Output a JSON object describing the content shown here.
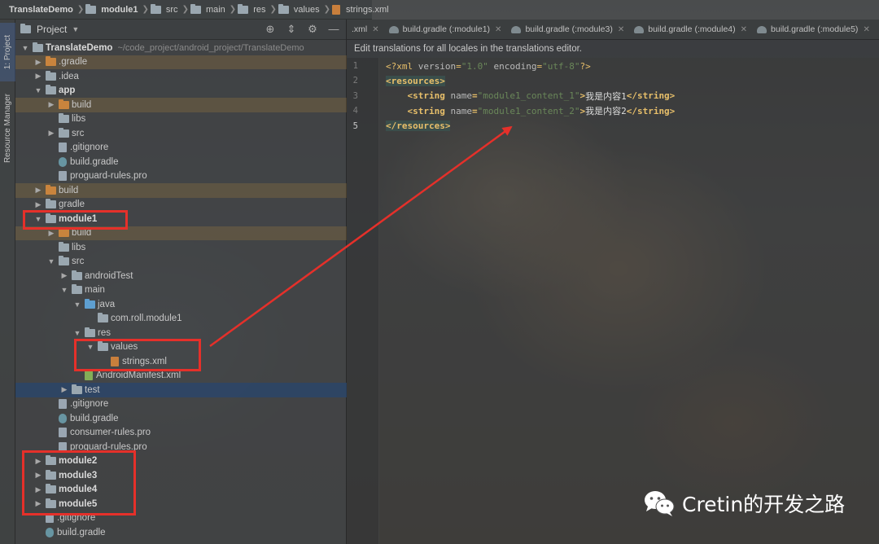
{
  "breadcrumb": [
    {
      "label": "TranslateDemo",
      "bold": true,
      "icon": "folder-icon"
    },
    {
      "label": "module1",
      "bold": true,
      "icon": "module-folder-icon"
    },
    {
      "label": "src",
      "bold": false,
      "icon": "folder-icon"
    },
    {
      "label": "main",
      "bold": false,
      "icon": "folder-icon"
    },
    {
      "label": "res",
      "bold": false,
      "icon": "folder-icon"
    },
    {
      "label": "values",
      "bold": false,
      "icon": "folder-icon"
    },
    {
      "label": "strings.xml",
      "bold": false,
      "icon": "xml-file-icon"
    }
  ],
  "tool_strip": {
    "project_tab": "1: Project",
    "resource_manager_tab": "Resource Manager"
  },
  "project_panel": {
    "title": "Project",
    "tools": [
      "target-icon",
      "collapse-all-icon",
      "settings-icon",
      "hide-icon"
    ],
    "tree": [
      {
        "label": "TranslateDemo",
        "depth": 0,
        "expanded": true,
        "icon": "module-folder-icon",
        "bold": true,
        "path": "~/code_project/android_project/TranslateDemo"
      },
      {
        "label": ".gradle",
        "depth": 1,
        "expanded": false,
        "icon": "orange-folder-icon",
        "highlight": "orange"
      },
      {
        "label": ".idea",
        "depth": 1,
        "expanded": false,
        "icon": "folder-icon"
      },
      {
        "label": "app",
        "depth": 1,
        "expanded": true,
        "icon": "module-folder-icon",
        "bold": true
      },
      {
        "label": "build",
        "depth": 2,
        "expanded": false,
        "icon": "orange-folder-icon",
        "highlight": "orange"
      },
      {
        "label": "libs",
        "depth": 2,
        "icon": "folder-icon"
      },
      {
        "label": "src",
        "depth": 2,
        "expanded": false,
        "icon": "folder-icon"
      },
      {
        "label": ".gitignore",
        "depth": 2,
        "icon": "gitignore-file-icon"
      },
      {
        "label": "build.gradle",
        "depth": 2,
        "icon": "gradle-file-icon"
      },
      {
        "label": "proguard-rules.pro",
        "depth": 2,
        "icon": "text-file-icon"
      },
      {
        "label": "build",
        "depth": 1,
        "expanded": false,
        "icon": "orange-folder-icon",
        "highlight": "orange"
      },
      {
        "label": "gradle",
        "depth": 1,
        "expanded": false,
        "icon": "folder-icon"
      },
      {
        "label": "module1",
        "depth": 1,
        "expanded": true,
        "icon": "module-folder-icon",
        "bold": true
      },
      {
        "label": "build",
        "depth": 2,
        "expanded": false,
        "icon": "orange-folder-icon",
        "highlight": "orange"
      },
      {
        "label": "libs",
        "depth": 2,
        "icon": "folder-icon"
      },
      {
        "label": "src",
        "depth": 2,
        "expanded": true,
        "icon": "folder-icon"
      },
      {
        "label": "androidTest",
        "depth": 3,
        "expanded": false,
        "icon": "folder-icon"
      },
      {
        "label": "main",
        "depth": 3,
        "expanded": true,
        "icon": "folder-icon"
      },
      {
        "label": "java",
        "depth": 4,
        "expanded": true,
        "icon": "blue-folder-icon"
      },
      {
        "label": "com.roll.module1",
        "depth": 5,
        "icon": "package-icon"
      },
      {
        "label": "res",
        "depth": 4,
        "expanded": true,
        "icon": "res-folder-icon"
      },
      {
        "label": "values",
        "depth": 5,
        "expanded": true,
        "icon": "folder-icon"
      },
      {
        "label": "strings.xml",
        "depth": 6,
        "icon": "xml-file-icon"
      },
      {
        "label": "AndroidManifest.xml",
        "depth": 4,
        "icon": "manifest-file-icon"
      },
      {
        "label": "test",
        "depth": 3,
        "expanded": false,
        "icon": "folder-icon",
        "selected": true
      },
      {
        "label": ".gitignore",
        "depth": 2,
        "icon": "gitignore-file-icon"
      },
      {
        "label": "build.gradle",
        "depth": 2,
        "icon": "gradle-file-icon"
      },
      {
        "label": "consumer-rules.pro",
        "depth": 2,
        "icon": "text-file-icon"
      },
      {
        "label": "proguard-rules.pro",
        "depth": 2,
        "icon": "text-file-icon"
      },
      {
        "label": "module2",
        "depth": 1,
        "expanded": false,
        "icon": "module-folder-icon",
        "bold": true
      },
      {
        "label": "module3",
        "depth": 1,
        "expanded": false,
        "icon": "module-folder-icon",
        "bold": true
      },
      {
        "label": "module4",
        "depth": 1,
        "expanded": false,
        "icon": "module-folder-icon",
        "bold": true
      },
      {
        "label": "module5",
        "depth": 1,
        "expanded": false,
        "icon": "module-folder-icon",
        "bold": true
      },
      {
        "label": ".gitignore",
        "depth": 1,
        "icon": "gitignore-file-icon"
      },
      {
        "label": "build.gradle",
        "depth": 1,
        "icon": "gradle-file-icon"
      }
    ]
  },
  "editor": {
    "tabs": [
      {
        "label": ".xml",
        "icon": "xml-file-icon"
      },
      {
        "label": "build.gradle (:module1)",
        "icon": "gradle-file-icon"
      },
      {
        "label": "build.gradle (:module3)",
        "icon": "gradle-file-icon"
      },
      {
        "label": "build.gradle (:module4)",
        "icon": "gradle-file-icon"
      },
      {
        "label": "build.gradle (:module5)",
        "icon": "gradle-file-icon"
      },
      {
        "label": "b",
        "icon": "gradle-file-icon"
      }
    ],
    "notice": "Edit translations for all locales in the translations editor.",
    "line_numbers": [
      "1",
      "2",
      "3",
      "4",
      "5"
    ],
    "current_line": 5,
    "code": [
      {
        "indent": "",
        "parts": [
          [
            "pi",
            "<?xml "
          ],
          [
            "attr",
            "version"
          ],
          [
            "pi",
            "="
          ],
          [
            "val",
            "\"1.0\""
          ],
          [
            "pi",
            " "
          ],
          [
            "attr",
            "encoding"
          ],
          [
            "pi",
            "="
          ],
          [
            "val",
            "\"utf-8\""
          ],
          [
            "pi",
            "?>"
          ]
        ]
      },
      {
        "indent": "",
        "parts": [
          [
            "taghl",
            "<resources>"
          ]
        ]
      },
      {
        "indent": "    ",
        "parts": [
          [
            "tag",
            "<string "
          ],
          [
            "attr",
            "name"
          ],
          [
            "tag",
            "="
          ],
          [
            "val",
            "\"module1_content_1\""
          ],
          [
            "tag",
            ">"
          ],
          [
            "text",
            "我是内容1"
          ],
          [
            "tag",
            "</string>"
          ]
        ]
      },
      {
        "indent": "    ",
        "parts": [
          [
            "tag",
            "<string "
          ],
          [
            "attr",
            "name"
          ],
          [
            "tag",
            "="
          ],
          [
            "val",
            "\"module1_content_2\""
          ],
          [
            "tag",
            ">"
          ],
          [
            "text",
            "我是内容2"
          ],
          [
            "tag",
            "</string>"
          ]
        ]
      },
      {
        "indent": "",
        "parts": [
          [
            "taghl",
            "</resources>"
          ]
        ]
      }
    ]
  },
  "annotations": {
    "box_color": "#e5302a",
    "arrow_color": "#e5302a"
  },
  "watermark": {
    "icon": "wechat-icon",
    "text": "Cretin的开发之路"
  },
  "colors": {
    "xml_tag": "#e8bf6a",
    "xml_value": "#6a8759",
    "selection": "#284670"
  }
}
